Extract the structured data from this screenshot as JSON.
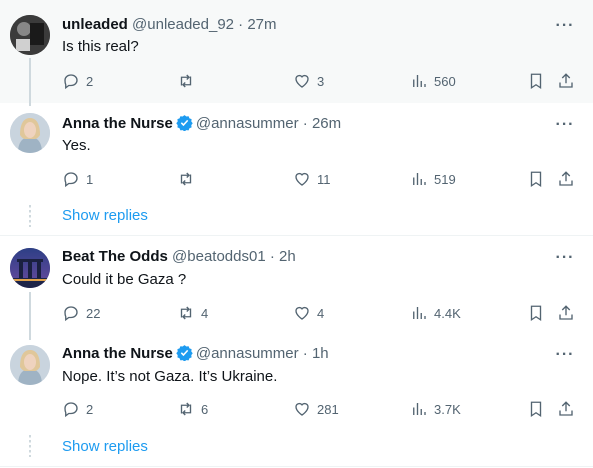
{
  "icons": {
    "reply": "reply-icon",
    "retweet": "retweet-icon",
    "like": "heart-icon",
    "views": "views-chart-icon",
    "bookmark": "bookmark-icon",
    "share": "share-icon",
    "more": "more-dots-icon",
    "verified": "verified-badge-icon"
  },
  "colors": {
    "link": "#1d9bf0",
    "muted": "#536471",
    "verified": "#1d9bf0"
  },
  "tweets": [
    {
      "name": "unleaded",
      "meta": "@unleaded_92 · 27m",
      "text": "Is this real?",
      "replies": "2",
      "retweets": "",
      "likes": "3",
      "views": "560",
      "more": "···"
    },
    {
      "name": "Anna the Nurse",
      "meta": "@annasummer · 26m",
      "text": "Yes.",
      "replies": "1",
      "retweets": "",
      "likes": "11",
      "views": "519",
      "more": "···"
    },
    {
      "name": "Beat The Odds",
      "meta": "@beatodds01 · 2h",
      "text": "Could it be Gaza ?",
      "replies": "22",
      "retweets": "4",
      "likes": "4",
      "views": "4.4K",
      "more": "···"
    },
    {
      "name": "Anna the Nurse",
      "meta": "@annasummer · 1h",
      "text": "Nope. It’s not Gaza. It’s Ukraine.",
      "replies": "2",
      "retweets": "6",
      "likes": "281",
      "views": "3.7K",
      "more": "···"
    }
  ],
  "show_replies": [
    "Show replies",
    "Show replies"
  ]
}
